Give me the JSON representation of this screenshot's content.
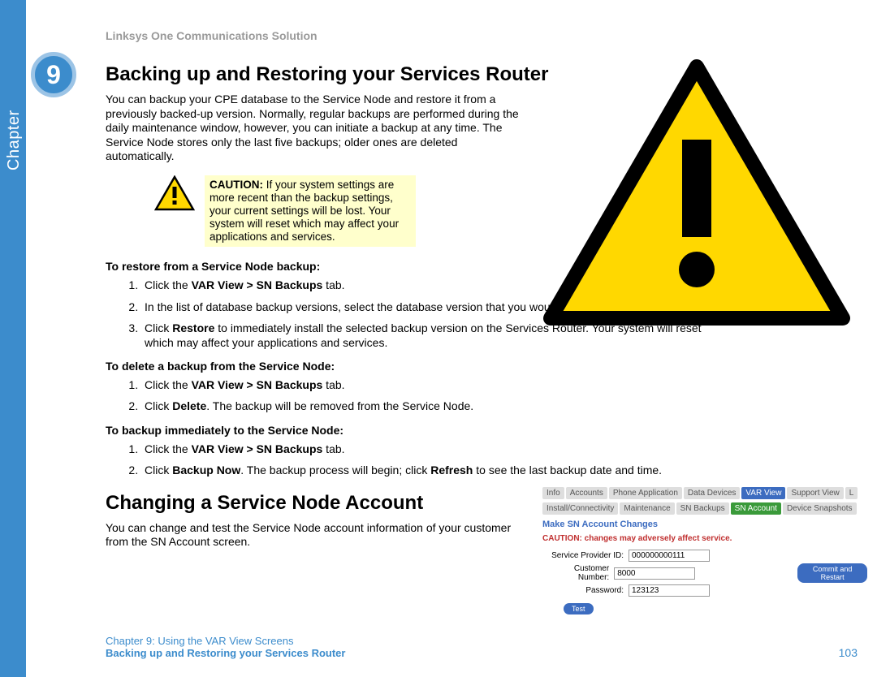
{
  "header": {
    "product_line": "Linksys One Communications Solution"
  },
  "chapter": {
    "number": "9",
    "label": "Chapter"
  },
  "sections": {
    "backup": {
      "title": "Backing up and Restoring your Services Router",
      "intro": "You can backup your CPE database to the Service Node and restore it from a previously backed-up version. Normally, regular backups are performed during the daily maintenance window, however, you can initiate a backup at any time. The Service Node stores only the last five backups; older ones are deleted automatically.",
      "caution_label": "CAUTION:",
      "caution_body": " If your system settings are more recent than the backup settings, your current settings will be lost. Your system will reset which may affect your applications and services.",
      "restore_heading": "To restore from a Service Node backup:",
      "restore_steps": [
        "Click the <b>VAR View > SN Backups</b> tab.",
        "In the list of database backup versions, select the database version that you would like to install.",
        "Click <b>Restore</b> to immediately install the selected backup version on the Services Router. Your system will reset which may affect your applications and services."
      ],
      "delete_heading": "To delete a backup from the Service Node:",
      "delete_steps": [
        "Click the <b>VAR View > SN Backups</b> tab.",
        "Click <b>Delete</b>. The backup will be removed from the Service Node."
      ],
      "immediate_heading": "To backup immediately to the Service Node:",
      "immediate_steps": [
        "Click the <b>VAR View > SN Backups</b> tab.",
        "Click <b>Backup Now</b>. The backup process will begin; click <b>Refresh</b> to see the last backup date and time."
      ]
    },
    "change": {
      "title": "Changing a Service Node Account",
      "intro": "You can change and test the Service Node account information of your customer from the SN Account screen."
    }
  },
  "inset": {
    "tabs_top": [
      "Info",
      "Accounts",
      "Phone Application",
      "Data Devices",
      "VAR View",
      "Support View",
      "L"
    ],
    "tabs_top_active": 4,
    "tabs_sub": [
      "Install/Connectivity",
      "Maintenance",
      "SN Backups",
      "SN Account",
      "Device Snapshots"
    ],
    "tabs_sub_active": 3,
    "heading": "Make SN Account Changes",
    "caution": "CAUTION: changes may adversely affect service.",
    "fields": {
      "sp_label": "Service Provider ID:",
      "sp_value": "000000000111",
      "cust_label": "Customer Number:",
      "cust_value": "8000",
      "pwd_label": "Password:",
      "pwd_value": "123123"
    },
    "buttons": {
      "commit": "Commit and Restart",
      "test": "Test"
    }
  },
  "footer": {
    "chapter_line": "Chapter 9: Using the VAR View Screens",
    "section_line": "Backing up and Restoring your Services Router",
    "page": "103"
  }
}
